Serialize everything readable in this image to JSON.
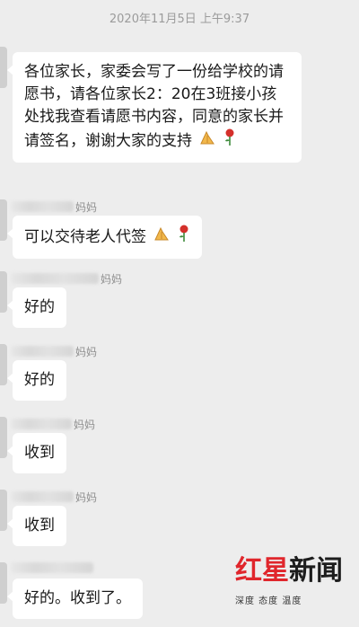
{
  "chat": {
    "timestamp": "2020年11月5日 上午9:37",
    "messages": [
      {
        "sender_suffix": "",
        "text": "各位家长，家委会写了一份给学校的请愿书，请各位家长2：20在3班接小孩处找我查看请愿书内容，同意的家长并请签名，谢谢大家的支持"
      },
      {
        "sender_suffix": "妈妈",
        "text": "可以交待老人代签"
      },
      {
        "sender_suffix": "妈妈",
        "text": "好的"
      },
      {
        "sender_suffix": "妈妈",
        "text": "好的"
      },
      {
        "sender_suffix": "妈妈",
        "text": "收到"
      },
      {
        "sender_suffix": "妈妈",
        "text": "收到"
      },
      {
        "sender_suffix": "",
        "text": "好的。收到了。"
      }
    ],
    "emoji_icons": [
      "folded-hands-icon",
      "rose-icon"
    ]
  },
  "watermark": {
    "brand_red": "红星",
    "brand_dark": "新闻",
    "slogan": "深度 态度 温度",
    "colors": {
      "red": "#e0262c",
      "dark": "#1d1d1d"
    }
  }
}
